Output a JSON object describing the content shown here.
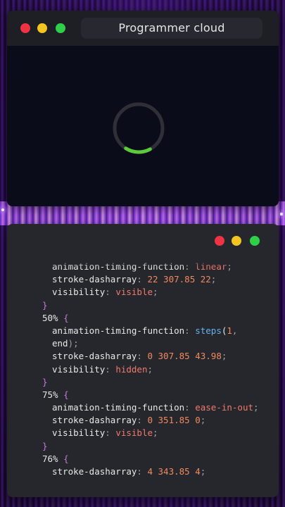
{
  "window_top": {
    "title": "Programmer cloud",
    "loader": {
      "progress": 0.17,
      "ring_color": "#2e2f37",
      "arc_color": "#5ccb3a"
    }
  },
  "window_bottom": {
    "lines": [
      {
        "indent": true,
        "parts": [
          {
            "t": "animation-timing-function",
            "c": "prop"
          },
          {
            "t": ": ",
            "c": "colon"
          },
          {
            "t": "linear",
            "c": "kw"
          },
          {
            "t": ";",
            "c": "colon"
          }
        ]
      },
      {
        "indent": true,
        "parts": [
          {
            "t": "stroke-dasharray",
            "c": "prop"
          },
          {
            "t": ": ",
            "c": "colon"
          },
          {
            "t": "22 307.85 22",
            "c": "num"
          },
          {
            "t": ";",
            "c": "colon"
          }
        ]
      },
      {
        "indent": true,
        "parts": [
          {
            "t": "visibility",
            "c": "prop"
          },
          {
            "t": ": ",
            "c": "colon"
          },
          {
            "t": "visible",
            "c": "kw"
          },
          {
            "t": ";",
            "c": "colon"
          }
        ]
      },
      {
        "indent": false,
        "parts": [
          {
            "t": "}",
            "c": "brace"
          }
        ]
      },
      {
        "indent": false,
        "parts": [
          {
            "t": "50%",
            "c": "pct"
          },
          {
            "t": " {",
            "c": "brace"
          }
        ]
      },
      {
        "indent": true,
        "parts": [
          {
            "t": "animation-timing-function",
            "c": "prop"
          },
          {
            "t": ": ",
            "c": "colon"
          },
          {
            "t": "steps",
            "c": "fn"
          },
          {
            "t": "(",
            "c": "prop"
          },
          {
            "t": "1",
            "c": "num"
          },
          {
            "t": ",",
            "c": "colon"
          }
        ]
      },
      {
        "indent": true,
        "parts": [
          {
            "t": "end",
            "c": "prop"
          },
          {
            "t": ");",
            "c": "colon"
          }
        ]
      },
      {
        "indent": true,
        "parts": [
          {
            "t": "stroke-dasharray",
            "c": "prop"
          },
          {
            "t": ": ",
            "c": "colon"
          },
          {
            "t": "0 307.85 43.98",
            "c": "num"
          },
          {
            "t": ";",
            "c": "colon"
          }
        ]
      },
      {
        "indent": true,
        "parts": [
          {
            "t": "visibility",
            "c": "prop"
          },
          {
            "t": ": ",
            "c": "colon"
          },
          {
            "t": "hidden",
            "c": "kw"
          },
          {
            "t": ";",
            "c": "colon"
          }
        ]
      },
      {
        "indent": false,
        "parts": [
          {
            "t": "}",
            "c": "brace"
          }
        ]
      },
      {
        "indent": false,
        "parts": [
          {
            "t": "75%",
            "c": "pct"
          },
          {
            "t": " {",
            "c": "brace"
          }
        ]
      },
      {
        "indent": true,
        "parts": [
          {
            "t": "animation-timing-function",
            "c": "prop"
          },
          {
            "t": ": ",
            "c": "colon"
          },
          {
            "t": "ease-in-out",
            "c": "kw"
          },
          {
            "t": ";",
            "c": "colon"
          }
        ]
      },
      {
        "indent": true,
        "parts": [
          {
            "t": "stroke-dasharray",
            "c": "prop"
          },
          {
            "t": ": ",
            "c": "colon"
          },
          {
            "t": "0 351.85 0",
            "c": "num"
          },
          {
            "t": ";",
            "c": "colon"
          }
        ]
      },
      {
        "indent": true,
        "parts": [
          {
            "t": "visibility",
            "c": "prop"
          },
          {
            "t": ": ",
            "c": "colon"
          },
          {
            "t": "visible",
            "c": "kw"
          },
          {
            "t": ";",
            "c": "colon"
          }
        ]
      },
      {
        "indent": false,
        "parts": [
          {
            "t": "}",
            "c": "brace"
          }
        ]
      },
      {
        "indent": false,
        "parts": [
          {
            "t": "76%",
            "c": "pct"
          },
          {
            "t": " {",
            "c": "brace"
          }
        ]
      },
      {
        "indent": true,
        "parts": [
          {
            "t": "stroke-dasharray",
            "c": "prop"
          },
          {
            "t": ": ",
            "c": "colon"
          },
          {
            "t": "4 343.85 4",
            "c": "num"
          },
          {
            "t": ";",
            "c": "colon"
          }
        ]
      }
    ]
  },
  "colors": {
    "red_dot": "#ee3344",
    "yellow_dot": "#f4c51f",
    "green_dot": "#2fcf48",
    "brace": "#c678dd",
    "value": "#f08a5d",
    "function": "#62b4ef"
  }
}
